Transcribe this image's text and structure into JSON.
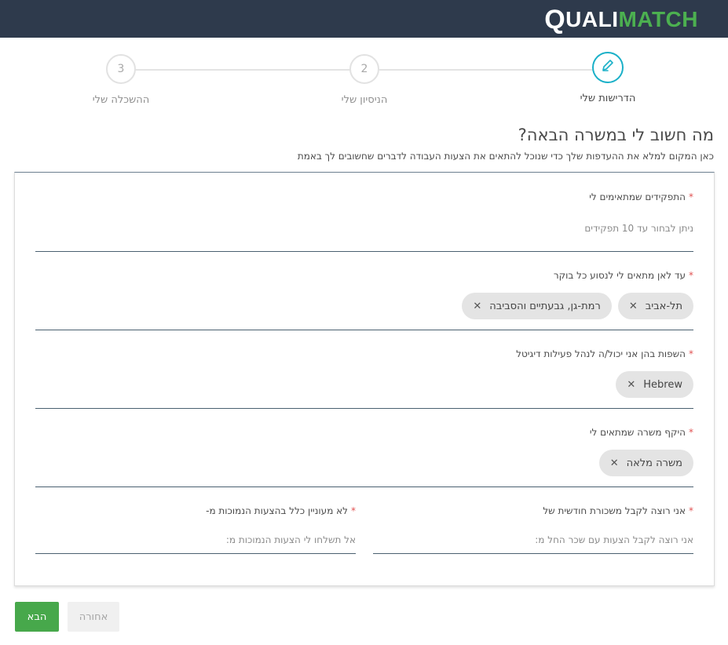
{
  "header": {
    "logo_q": "Q",
    "logo_quali": "UALI",
    "logo_match": "MATCH",
    "colors": {
      "bar": "#2e3a4c",
      "brand_green": "#4cb050"
    }
  },
  "stepper": {
    "steps": [
      {
        "number": "",
        "label": "הדרישות שלי",
        "icon": "pencil-icon",
        "active": true
      },
      {
        "number": "2",
        "label": "הניסיון שלי",
        "active": false
      },
      {
        "number": "3",
        "label": "ההשכלה שלי",
        "active": false
      }
    ],
    "accent": "#1ab0c8"
  },
  "page": {
    "title": "מה חשוב לי במשרה הבאה?",
    "subtitle": "כאן המקום למלא את ההעדפות שלך כדי שנוכל להתאים את הצעות העבודה לדברים שחשובים לך באמת"
  },
  "form": {
    "roles": {
      "label": "התפקידים שמתאימים לי",
      "placeholder": "ניתן לבחור עד 10 תפקידים",
      "required": "*"
    },
    "travel": {
      "label": "עד לאן מתאים לי לנסוע כל בוקר",
      "required": "*",
      "chips": [
        "תל-אביב",
        "רמת-גן, גבעתיים והסביבה"
      ]
    },
    "languages": {
      "label": "השפות בהן אני יכול/ה לנהל פעילות דיגיטל",
      "required": "*",
      "chips": [
        "Hebrew"
      ]
    },
    "scope": {
      "label": "היקף משרה שמתאים לי",
      "required": "*",
      "chips": [
        "משרה מלאה"
      ]
    },
    "salary": {
      "label": "אני רוצה לקבל משכורת חודשית של",
      "required": "*",
      "placeholder": "אני רוצה לקבל הצעות עם שכר החל מ:"
    },
    "not_interested": {
      "label": "לא מעוניין כלל בהצעות הנמוכות מ-",
      "required": "*",
      "placeholder": "אל תשלחו לי הצעות הנמוכות מ:"
    },
    "chip_remove": "✕"
  },
  "footer": {
    "next_label": "הבא",
    "back_label": "אחורה",
    "next_color": "#47a84b"
  }
}
